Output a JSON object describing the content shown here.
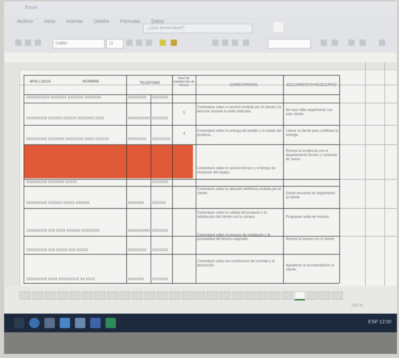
{
  "window": {
    "title": "Excel"
  },
  "ribbon": {
    "tabs": [
      "Archivo",
      "Inicio",
      "Insertar",
      "Diseño",
      "Fórmulas",
      "Datos"
    ],
    "search_placeholder": "¿Qué desea hacer?",
    "font_name": "Calibri",
    "font_size": "11"
  },
  "table": {
    "headers": {
      "col_a": "APELLIDOS",
      "col_b": "NOMBRE",
      "col_c": "TELEFONO",
      "col_d": "Nivel de Satisfacción de Cliente",
      "col_e": "COMENTARIOS",
      "col_f": "SEGUIMIENTO NECESARIO"
    },
    "rows": [
      {
        "name": "XXXXXXXXXX XXXXXXX XXXXXXX XXXXXXX",
        "phone": "XXXXXXXX",
        "phone2": "XXXXXXX",
        "rating": "",
        "comment": "",
        "followup": ""
      },
      {
        "name": "XXXXXXXXX XXXXXX XXXXXX XXXXXXX XXXX",
        "phone": "XXXXXXXXXX",
        "phone2": "XXXXXXX",
        "rating": "5",
        "comment": "Comentario sobre el servicio recibido por el cliente y la atención durante la visita realizada.",
        "followup": "No hace falta seguimiento con este cliente."
      },
      {
        "name": "XXXXXXXXX XXXXXXX XXXXXXXX XXXX XXXXXX",
        "phone": "XXXXXXXX",
        "phone2": "XXXXXXXX",
        "rating": "4",
        "comment": "Comentario sobre la entrega del pedido y el estado del producto.",
        "followup": "Llamar al cliente para confirmar la entrega."
      },
      {
        "name": "",
        "phone": "",
        "phone2": "",
        "rating": "",
        "comment": "Comentario sobre el servicio técnico y el tiempo de respuesta del equipo.",
        "followup": "Revisar la incidencia con el departamento técnico y contactar de nuevo."
      },
      {
        "name": "XXXXXXXXX XXXXXXX XXXXX",
        "phone": "",
        "phone2": "XXXXXXX",
        "rating": "",
        "comment": "Comentario sobre la atención telefónica recibida por el cliente.",
        "followup": ""
      },
      {
        "name": "XXXXXXXXX XXXXXX XXXXX XXXXXX",
        "phone": "XXXXXXX",
        "phone2": "XXXXXX",
        "rating": "",
        "comment": "Comentario sobre la calidad del producto y la satisfacción del cliente con la compra.",
        "followup": "Enviar encuesta de seguimiento al cliente."
      },
      {
        "name": "XXXXXXXXX XXX XXXX XXXXXX XXXXXXXX",
        "phone": "XXXXXXXXXX",
        "phone2": "XXXXXXX",
        "rating": "",
        "comment": "Comentario sobre el proceso de instalación y la puntualidad del técnico asignado.",
        "followup": "Programar visita de revisión."
      },
      {
        "name": "XXXXXXXXX XXX XXXXX XXX XXXXX",
        "phone": "XXXXXXXX",
        "phone2": "XXXXXXX",
        "rating": "",
        "comment": "Comentario sobre las condiciones del contrato y la facturación.",
        "followup": "Revisar la factura con el cliente."
      },
      {
        "name": "XXXXXXXXX XXXX XXXXXXXXX XX XXXX",
        "phone": "XXXXXXX",
        "phone2": "XXXXXXX",
        "rating": "",
        "comment": "Comentario sobre la recomendación del servicio a otras personas.",
        "followup": "Agradecer la recomendación al cliente."
      }
    ]
  },
  "statusbar": {
    "zoom": "100 %"
  },
  "taskbar": {
    "tray_text": "ESP 12:00"
  }
}
